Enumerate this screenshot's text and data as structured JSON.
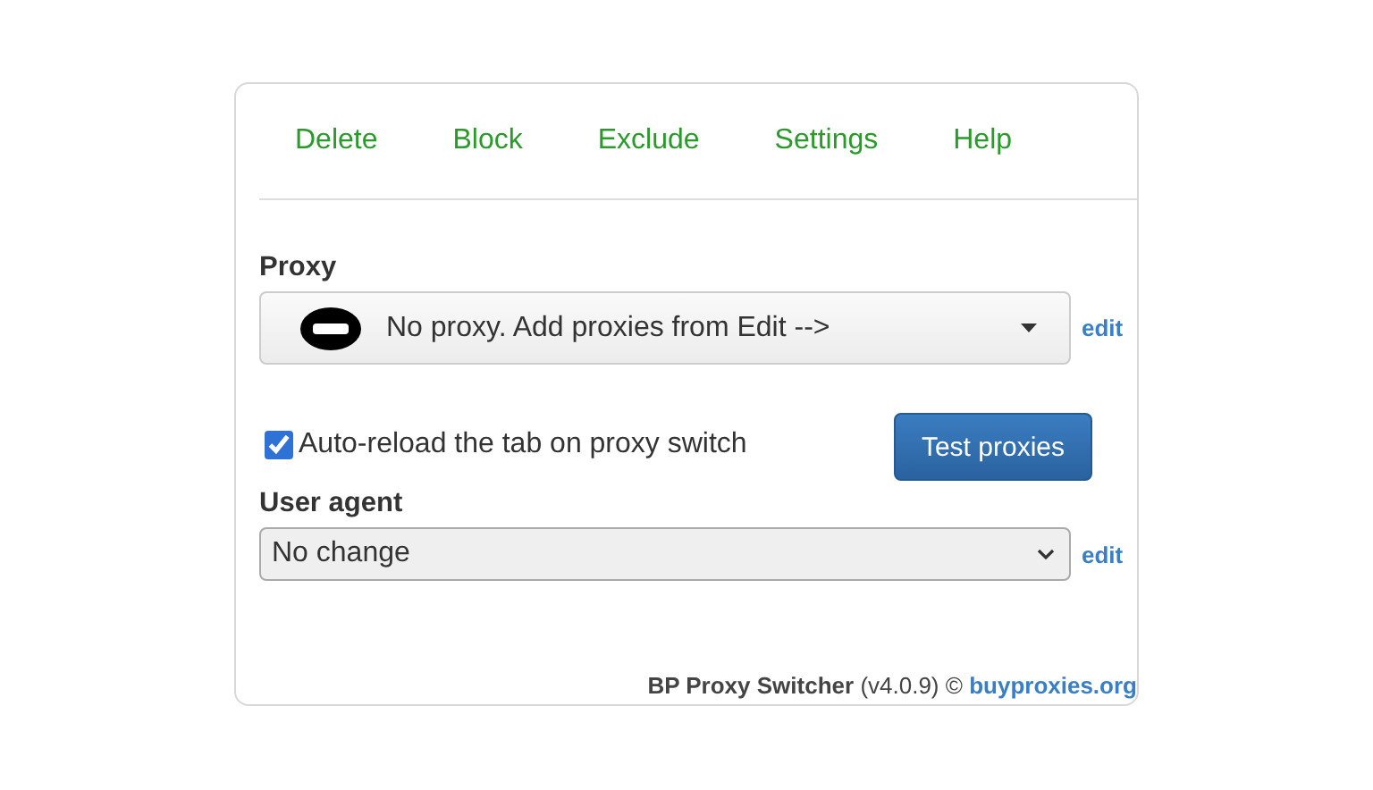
{
  "menu": [
    {
      "label": "Delete"
    },
    {
      "label": "Block"
    },
    {
      "label": "Exclude"
    },
    {
      "label": "Settings"
    },
    {
      "label": "Help"
    }
  ],
  "proxy": {
    "label": "Proxy",
    "value": "No proxy. Add proxies from Edit -->",
    "edit": "edit"
  },
  "auto_reload": {
    "label": "Auto-reload the tab on proxy switch",
    "checked": true
  },
  "test_button": "Test proxies",
  "user_agent": {
    "label": "User agent",
    "value": "No change",
    "edit": "edit"
  },
  "footer": {
    "text": "**BP Proxy Switcher** (v4.0.9) ©",
    "link": "buyproxies.org"
  }
}
